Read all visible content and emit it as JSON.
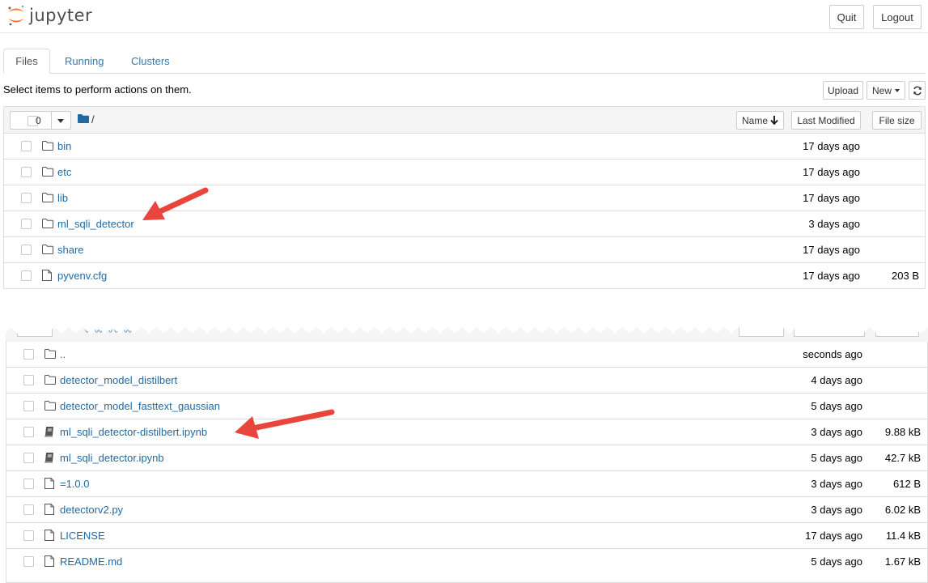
{
  "header": {
    "logo_text": "jupyter",
    "quit_label": "Quit",
    "logout_label": "Logout"
  },
  "tabs": [
    {
      "label": "Files",
      "active": true
    },
    {
      "label": "Running",
      "active": false
    },
    {
      "label": "Clusters",
      "active": false
    }
  ],
  "toolbar": {
    "message": "Select items to perform actions on them.",
    "upload_label": "Upload",
    "new_label": "New",
    "refresh_icon": "refresh-icon"
  },
  "top_listing": {
    "selected_count": "0",
    "breadcrumb": "/",
    "columns": {
      "name": "Name",
      "last_modified": "Last Modified",
      "file_size": "File size"
    },
    "rows": [
      {
        "name": "bin",
        "type": "folder",
        "modified": "17 days ago",
        "size": ""
      },
      {
        "name": "etc",
        "type": "folder",
        "modified": "17 days ago",
        "size": ""
      },
      {
        "name": "lib",
        "type": "folder",
        "modified": "17 days ago",
        "size": ""
      },
      {
        "name": "ml_sqli_detector",
        "type": "folder",
        "modified": "3 days ago",
        "size": ""
      },
      {
        "name": "share",
        "type": "folder",
        "modified": "17 days ago",
        "size": ""
      },
      {
        "name": "pyvenv.cfg",
        "type": "file",
        "modified": "17 days ago",
        "size": "203 B"
      }
    ]
  },
  "bottom_listing": {
    "rows": [
      {
        "name": "..",
        "type": "folder",
        "modified": "seconds ago",
        "size": ""
      },
      {
        "name": "detector_model_distilbert",
        "type": "folder",
        "modified": "4 days ago",
        "size": ""
      },
      {
        "name": "detector_model_fasttext_gaussian",
        "type": "folder",
        "modified": "5 days ago",
        "size": ""
      },
      {
        "name": "ml_sqli_detector-distilbert.ipynb",
        "type": "notebook",
        "modified": "3 days ago",
        "size": "9.88 kB"
      },
      {
        "name": "ml_sqli_detector.ipynb",
        "type": "notebook",
        "modified": "5 days ago",
        "size": "42.7 kB"
      },
      {
        "name": "=1.0.0",
        "type": "file",
        "modified": "3 days ago",
        "size": "612 B"
      },
      {
        "name": "detectorv2.py",
        "type": "file",
        "modified": "3 days ago",
        "size": "6.02 kB"
      },
      {
        "name": "LICENSE",
        "type": "file",
        "modified": "17 days ago",
        "size": "11.4 kB"
      },
      {
        "name": "README.md",
        "type": "file",
        "modified": "5 days ago",
        "size": "1.67 kB"
      }
    ]
  },
  "colors": {
    "link": "#1f6aa5",
    "jupyter_orange": "#f37726",
    "annotation_arrow": "#e8453c"
  }
}
